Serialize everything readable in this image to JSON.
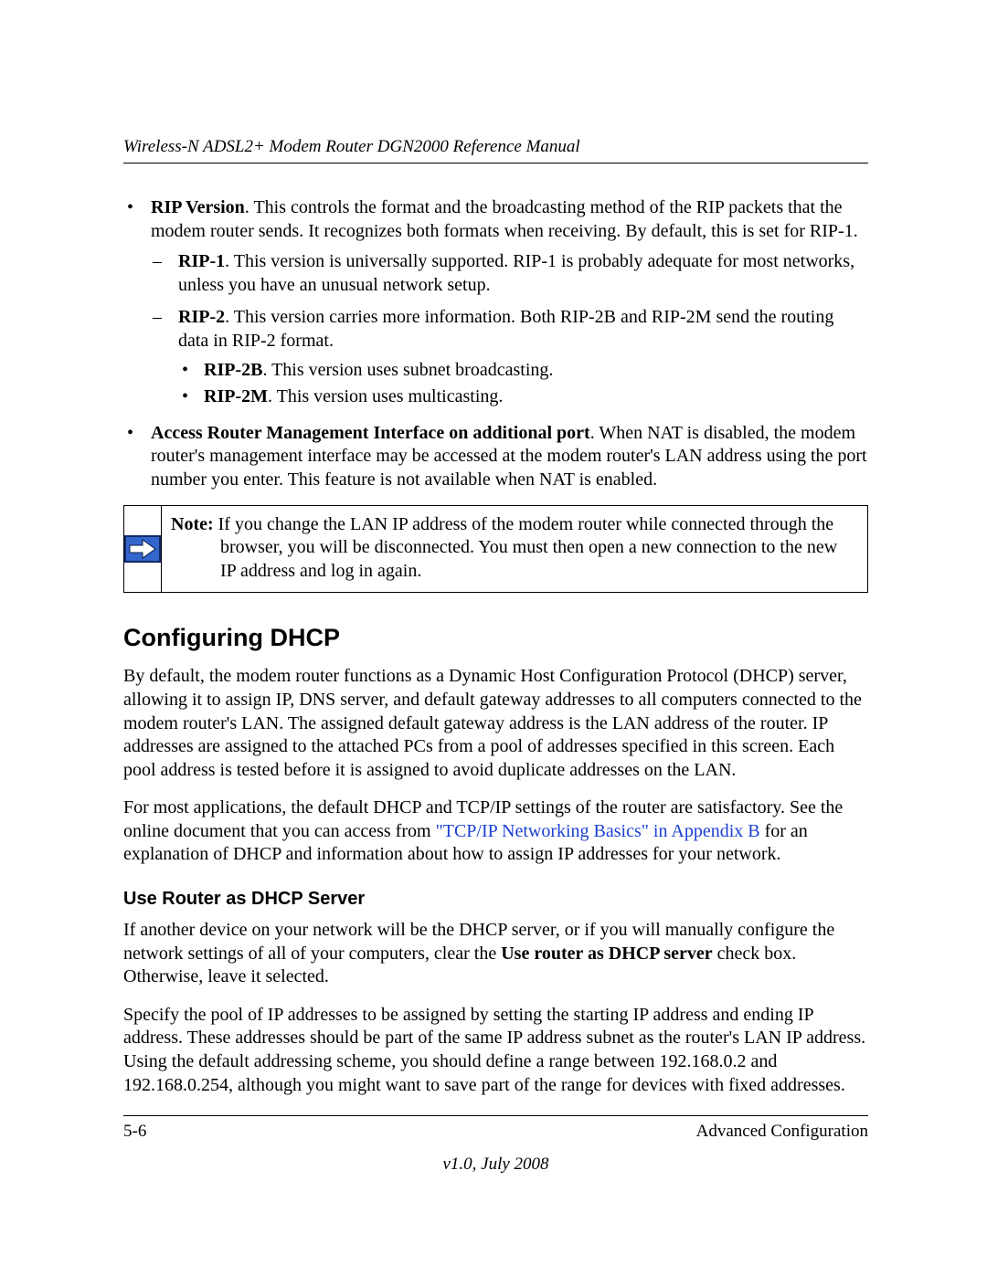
{
  "header": {
    "running_title": "Wireless-N ADSL2+ Modem Router DGN2000 Reference Manual"
  },
  "bullets": {
    "rip_version": {
      "term": "RIP Version",
      "text": ". This controls the format and the broadcasting method of the RIP packets that the modem router sends. It recognizes both formats when receiving. By default, this is set for RIP-1.",
      "rip1": {
        "term": "RIP-1",
        "text": ". This version is universally supported. RIP-1 is probably adequate for most networks, unless you have an unusual network setup."
      },
      "rip2": {
        "term": "RIP-2",
        "text": ". This version carries more information. Both RIP-2B and RIP-2M send the routing data in RIP-2 format.",
        "rip2b": {
          "term": "RIP-2B",
          "text": ". This version uses subnet broadcasting."
        },
        "rip2m": {
          "term": "RIP-2M",
          "text": ". This version uses multicasting."
        }
      }
    },
    "access_port": {
      "term": "Access Router Management Interface on additional port",
      "text": ". When NAT is disabled, the modem router's management interface may be accessed at the modem router's LAN address using the port number you enter. This feature is not available when NAT is enabled."
    }
  },
  "note": {
    "label": "Note:",
    "text": " If you change the LAN IP address of the modem router while connected through the browser, you will be disconnected. You must then open a new connection to the new IP address and log in again."
  },
  "section": {
    "heading": "Configuring DHCP",
    "p1": "By default, the modem router functions as a Dynamic Host Configuration Protocol (DHCP) server, allowing it to assign IP, DNS server, and default gateway addresses to all computers connected to the modem router's LAN. The assigned default gateway address is the LAN address of the router. IP addresses are assigned to the attached PCs from a pool of addresses specified in this screen. Each pool address is tested before it is assigned to avoid duplicate addresses on the LAN.",
    "p2_pre": "For most applications, the default DHCP and TCP/IP settings of the router are satisfactory. See the online document that you can access from ",
    "p2_link": "\"TCP/IP Networking Basics\" in Appendix B",
    "p2_post": " for an explanation of DHCP and information about how to assign IP addresses for your network."
  },
  "subsection": {
    "heading": "Use Router as DHCP Server",
    "p1_pre": "If another device on your network will be the DHCP server, or if you will manually configure the network settings of all of your computers, clear the ",
    "p1_bold": "Use router as DHCP server",
    "p1_post": " check box. Otherwise, leave it selected.",
    "p2": "Specify the pool of IP addresses to be assigned by setting the starting IP address and ending IP address. These addresses should be part of the same IP address subnet as the router's LAN IP address. Using the default addressing scheme, you should define a range between 192.168.0.2 and 192.168.0.254, although you might want to save part of the range for devices with fixed addresses."
  },
  "footer": {
    "page": "5-6",
    "chapter": "Advanced Configuration",
    "version": "v1.0, July 2008"
  }
}
